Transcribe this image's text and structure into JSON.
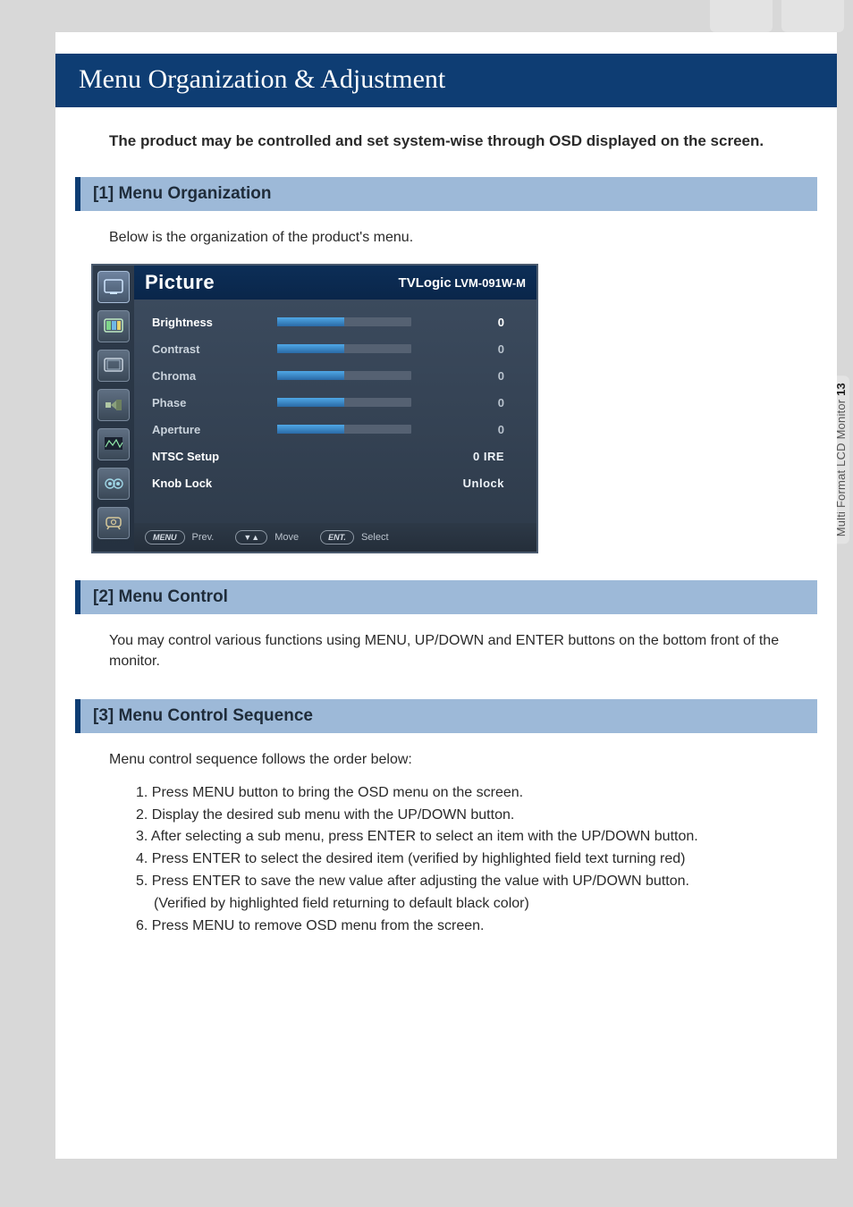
{
  "title": "Menu Organization & Adjustment",
  "intro": "The product may be controlled and set system-wise through OSD displayed on the screen.",
  "side_label_prefix": "Multi Format LCD Monitor ",
  "side_label_page": "13",
  "sections": {
    "s1": {
      "heading": "[1] Menu Organization",
      "body": "Below is the organization of the product's menu."
    },
    "s2": {
      "heading": "[2] Menu Control",
      "body": "You may control various functions using MENU, UP/DOWN and ENTER buttons on the bottom front of the monitor."
    },
    "s3": {
      "heading": "[3] Menu Control Sequence",
      "body": "Menu control sequence follows the order below:"
    }
  },
  "steps": [
    "1. Press MENU button to bring the OSD menu on the screen.",
    "2. Display the desired sub menu with the UP/DOWN button.",
    "3. After selecting a sub menu, press ENTER to select an item with the UP/DOWN button.",
    "4. Press ENTER to select the desired item (verified by highlighted field text turning red)",
    "5. Press ENTER to save the new value after adjusting the value with UP/DOWN button.",
    "    (Verified by highlighted field returning to default black color)",
    "6. Press MENU to remove OSD menu from the screen."
  ],
  "osd": {
    "title": "Picture",
    "brand": "TVLogic",
    "model": "LVM-091W-M",
    "rows": [
      {
        "label": "Brightness",
        "type": "slider",
        "value": "0"
      },
      {
        "label": "Contrast",
        "type": "slider",
        "value": "0"
      },
      {
        "label": "Chroma",
        "type": "slider",
        "value": "0"
      },
      {
        "label": "Phase",
        "type": "slider",
        "value": "0"
      },
      {
        "label": "Aperture",
        "type": "slider",
        "value": "0"
      },
      {
        "label": "NTSC Setup",
        "type": "text",
        "value": "0 IRE"
      },
      {
        "label": "Knob Lock",
        "type": "text",
        "value": "Unlock"
      }
    ],
    "footer": {
      "prev_btn": "MENU",
      "prev_lbl": "Prev.",
      "move_btn": "▼▲",
      "move_lbl": "Move",
      "sel_btn": "ENT.",
      "sel_lbl": "Select"
    }
  }
}
